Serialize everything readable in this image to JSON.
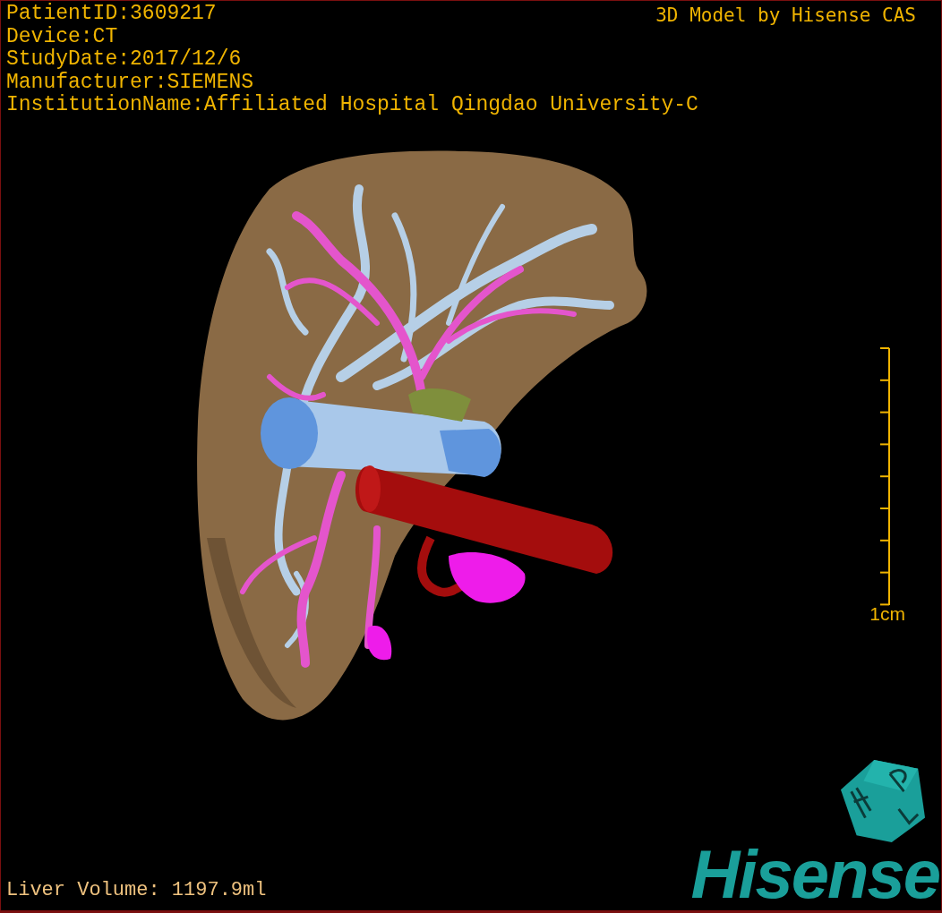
{
  "viewer": {
    "info_lines": [
      "PatientID:3609217",
      "Device:CT",
      "StudyDate:2017/12/6",
      "Manufacturer:SIEMENS",
      "InstitutionName:Affiliated Hospital Qingdao University-C"
    ],
    "title": "3D Model by Hisense CAS",
    "scale_label": "1cm",
    "measurement": "Liver Volume: 1197.9ml",
    "brand": "Hisense"
  }
}
